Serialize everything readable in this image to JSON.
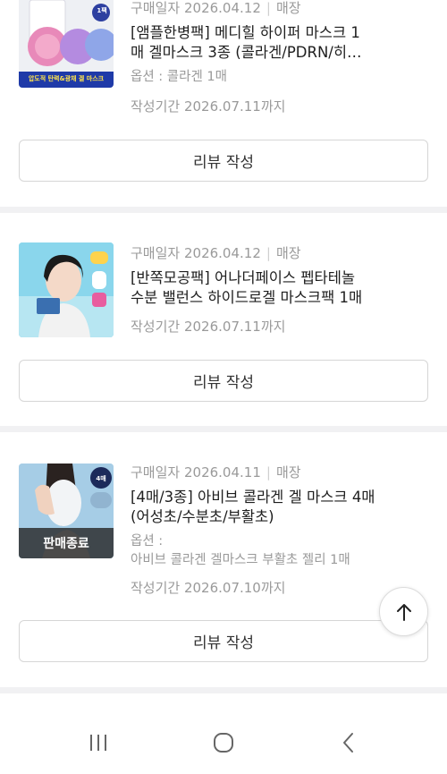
{
  "orders": [
    {
      "purchase_label": "구매일자",
      "purchase_date": "2026.04.12",
      "channel": "매장",
      "title_line1": "[앰플한병팩] 메디힐 하이퍼 마스크 1",
      "title_line2": "매 겔마스크 3종 (콜라겐/PDRN/히…",
      "option": "옵션 : 콜라겐 1매",
      "deadline": "작성기간 2026.07.11까지",
      "review_button": "리뷰 작성",
      "thumb_badge": "1팩",
      "thumb_caption": "압도적 탄력&광채 겔 마스크"
    },
    {
      "purchase_label": "구매일자",
      "purchase_date": "2026.04.12",
      "channel": "매장",
      "title_line1": "[반쪽모공팩] 어나더페이스 펩타테놀",
      "title_line2": "수분 밸런스 하이드로겔 마스크팩 1매",
      "deadline": "작성기간 2026.07.11까지",
      "review_button": "리뷰 작성"
    },
    {
      "purchase_label": "구매일자",
      "purchase_date": "2026.04.11",
      "channel": "매장",
      "title_line1": "[4매/3종] 아비브 콜라겐 겔 마스크 4매",
      "title_line2": "(어성초/수분초/부활초)",
      "option_label": "옵션 :",
      "option_value": "아비브 콜라겐 겔마스크 부활초 젤리 1매",
      "deadline": "작성기간 2026.07.10까지",
      "review_button": "리뷰 작성",
      "thumb_badge": "4매",
      "sold_out": "판매종료"
    }
  ],
  "colors": {
    "muted_text": "#9a9a9a",
    "divider": "#f1f1f3",
    "button_border": "#d6d6d6"
  }
}
